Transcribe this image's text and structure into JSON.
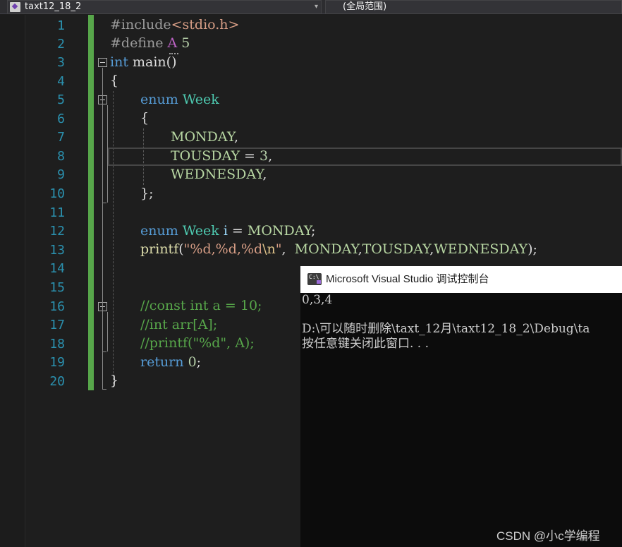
{
  "nav": {
    "file_label": "taxt12_18_2",
    "scope_label": "(全局范围)",
    "file_icon": "project-file-icon",
    "dropdown_icon": "chevron-down-icon"
  },
  "editor": {
    "line_numbers": [
      "1",
      "2",
      "3",
      "4",
      "5",
      "6",
      "7",
      "8",
      "9",
      "10",
      "11",
      "12",
      "13",
      "14",
      "15",
      "16",
      "17",
      "18",
      "19",
      "20"
    ],
    "lines": {
      "l1": {
        "a": "#include",
        "b": "<stdio.h>"
      },
      "l2": {
        "a": "#define ",
        "b": "A",
        "c": " 5"
      },
      "l3": {
        "a": "int",
        "b": " main()"
      },
      "l4": {
        "a": "{"
      },
      "l5": {
        "a": "enum",
        "b": " ",
        "c": "Week"
      },
      "l6": {
        "a": "{"
      },
      "l7": {
        "a": "MONDAY",
        "b": ","
      },
      "l8": {
        "a": "TOUSDAY",
        "b": " = ",
        "c": "3",
        "d": ","
      },
      "l9": {
        "a": "WEDNESDAY",
        "b": ","
      },
      "l10": {
        "a": "};"
      },
      "l12": {
        "a": "enum",
        "b": " ",
        "c": "Week",
        "d": " ",
        "e": "i",
        "f": " = ",
        "g": "MONDAY",
        "h": ";"
      },
      "l13": {
        "a": "printf",
        "b": "(",
        "c": "\"%d,%d,%d",
        "d": "\\n",
        "e": "\"",
        "f": ",  ",
        "g": "MONDAY",
        "h": ",",
        "i": "TOUSDAY",
        "j": ",",
        "k": "WEDNESDAY",
        "l": ");"
      },
      "l16": {
        "a": "//const int a = 10;"
      },
      "l17": {
        "a": "//int arr[A];"
      },
      "l18": {
        "a": "//printf(\"%d\", A);"
      },
      "l19": {
        "a": "return",
        "b": " ",
        "c": "0",
        "d": ";"
      },
      "l20": {
        "a": "}"
      }
    }
  },
  "console": {
    "title": "Microsoft Visual Studio 调试控制台",
    "icon": "console-app-icon",
    "output": [
      "0,3,4",
      "",
      "D:\\可以随时删除\\taxt_12月\\taxt12_18_2\\Debug\\ta",
      "按任意键关闭此窗口. . ."
    ]
  },
  "watermark": "CSDN @小c学编程",
  "colors": {
    "editor_bg": "#1e1e1e",
    "keyword": "#569cd6",
    "type": "#4ec9b0",
    "comment": "#57a64a",
    "line_number": "#2b91af",
    "change_bar": "#57a64a",
    "console_bg": "#0c0c0c"
  }
}
